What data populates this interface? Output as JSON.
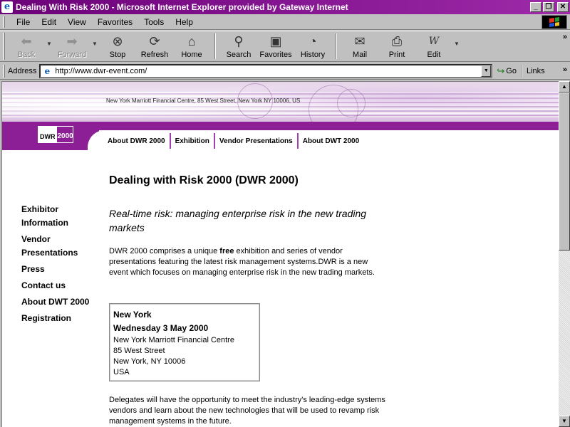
{
  "window": {
    "title": "Dealing With Risk 2000 - Microsoft Internet Explorer provided by Gateway Internet",
    "min": "_",
    "max": "❐",
    "close": "✕"
  },
  "menu": [
    "File",
    "Edit",
    "View",
    "Favorites",
    "Tools",
    "Help"
  ],
  "toolbar": {
    "back": "Back",
    "forward": "Forward",
    "stop": "Stop",
    "refresh": "Refresh",
    "home": "Home",
    "search": "Search",
    "favorites": "Favorites",
    "history": "History",
    "mail": "Mail",
    "print": "Print",
    "edit": "Edit",
    "more": "»"
  },
  "address": {
    "label": "Address",
    "url": "http://www.dwr-event.com/",
    "go": "Go",
    "links": "Links",
    "more": "»"
  },
  "page": {
    "banner_text": "New York Marriott Financial Centre, 85 West Street, New York NY 10006, US",
    "logo": {
      "left": "DWR",
      "right": "2000"
    },
    "nav": [
      "About DWR 2000",
      "Exhibition",
      "Vendor Presentations",
      "About DWT 2000"
    ],
    "title": "Dealing with Risk 2000 (DWR 2000)",
    "sidebar": [
      "Exhibitor Information",
      "Vendor Presentations",
      "Press",
      "Contact us",
      "About DWT 2000",
      "Registration"
    ],
    "subtitle": "Real-time risk: managing enterprise risk in the new trading markets",
    "intro_pre": "DWR 2000 comprises a unique ",
    "intro_bold": "free",
    "intro_post": " exhibition and series of vendor presentations featuring the latest risk management systems.DWR is a new event which focuses on managing enterprise risk in the new trading markets.",
    "venue": {
      "city": "New York",
      "date": "Wednesday 3 May 2000",
      "lines": [
        "New York Marriott Financial Centre",
        "85 West Street",
        "New York, NY 10006",
        "USA"
      ]
    },
    "delegates": "Delegates will have the opportunity to meet the industry's leading-edge systems vendors and learn about the new technologies that will be used to revamp risk management systems in the future."
  }
}
